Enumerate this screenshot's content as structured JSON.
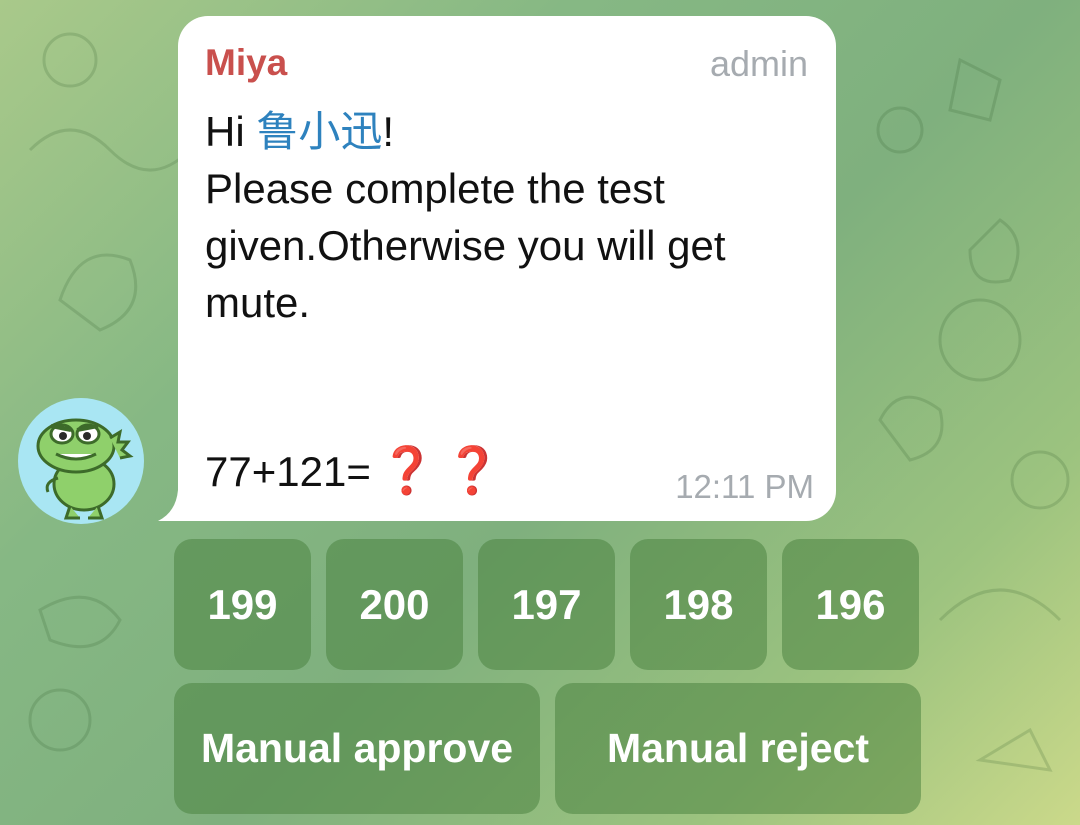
{
  "message": {
    "sender": "Miya",
    "role": "admin",
    "greeting_prefix": "Hi ",
    "mention": "鲁小迅",
    "greeting_suffix": "!",
    "body": "Please complete the test given.Otherwise you will get mute.",
    "equation": "77+121=",
    "question_marks": [
      "❓",
      "❓"
    ],
    "time": "12:11 PM"
  },
  "keyboard": {
    "answers": [
      "199",
      "200",
      "197",
      "198",
      "196"
    ],
    "approve_label": "Manual approve",
    "reject_label": "Manual reject"
  },
  "colors": {
    "sender": "#c9504d",
    "mention": "#2e82be",
    "question_mark": "#d81e1e",
    "meta": "#a6abb0",
    "avatar_bg": "#a9e6f3",
    "button_bg": "#5e9a52"
  },
  "icons": {
    "avatar": "green-dinosaur-sticker-avatar"
  }
}
